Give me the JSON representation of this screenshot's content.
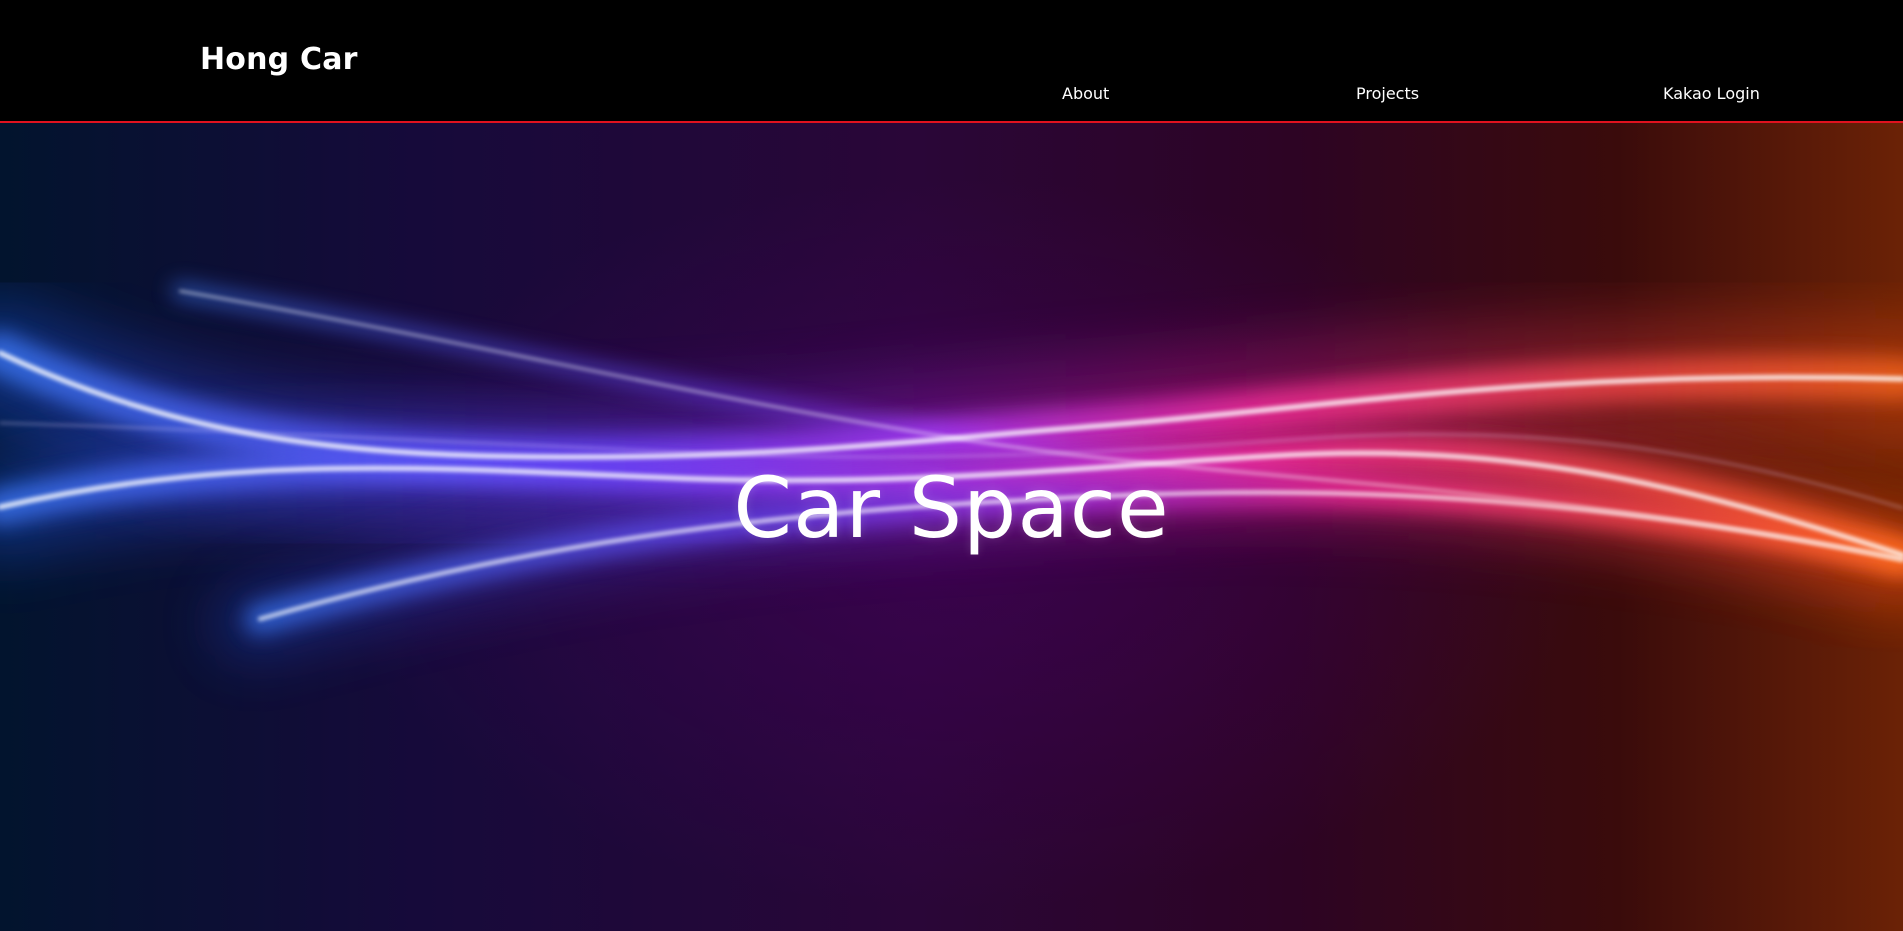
{
  "header": {
    "brand": "Hong Car",
    "nav": {
      "about": "About",
      "projects": "Projects",
      "kakao_login": "Kakao Login"
    }
  },
  "hero": {
    "title": "Car Space"
  },
  "colors": {
    "header_background": "#000000",
    "header_border": "#e0121f",
    "text": "#ffffff",
    "wave_blue": "#3f7cff",
    "wave_purple": "#b13cff",
    "wave_pink": "#ff2fa2",
    "wave_orange": "#ff6a22"
  }
}
